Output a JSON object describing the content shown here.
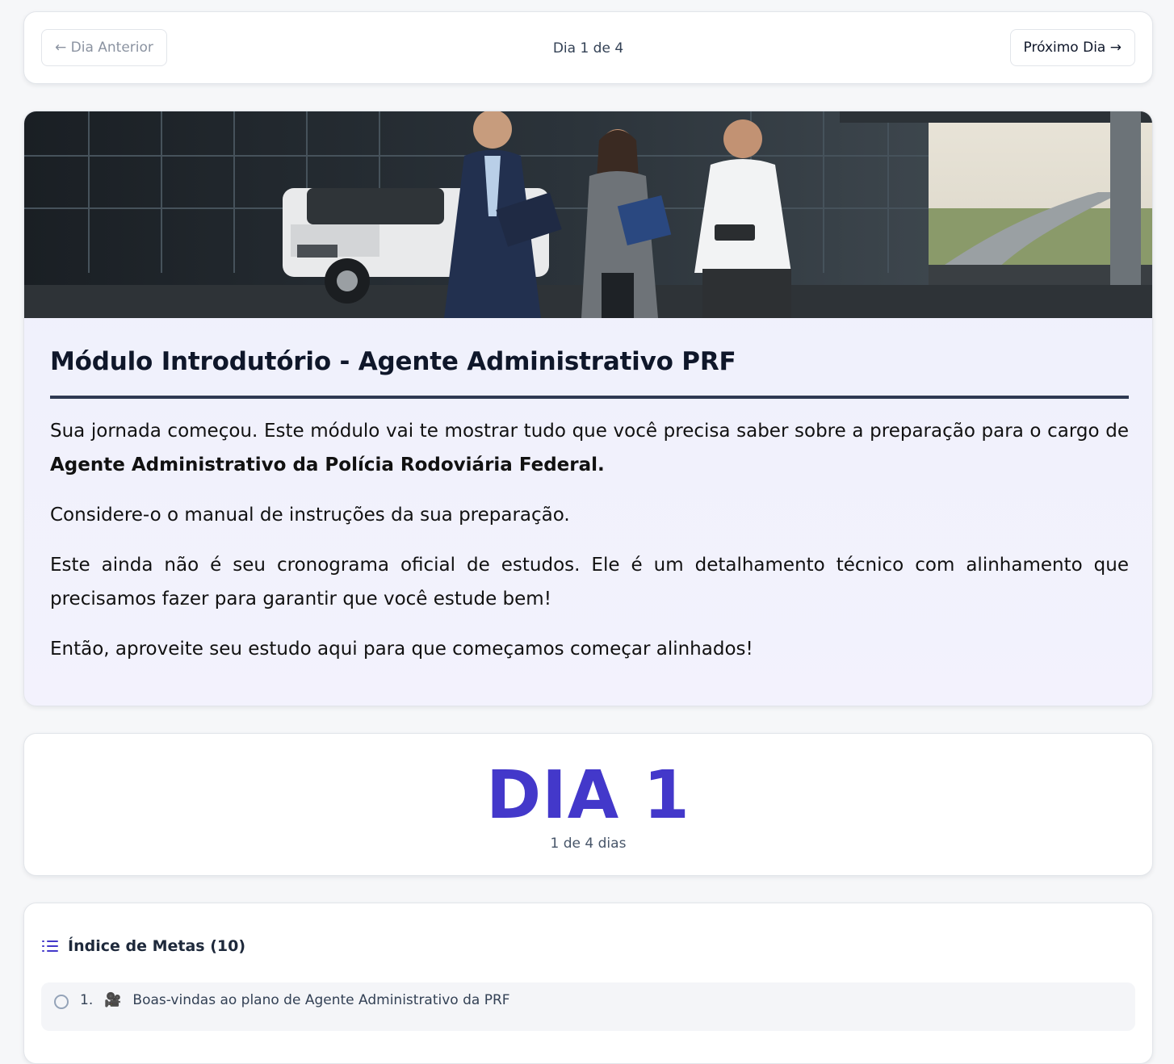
{
  "nav": {
    "prev_label": "← Dia Anterior",
    "counter": "Dia 1 de 4",
    "next_label": "Próximo Dia →"
  },
  "hero": {
    "title": "Módulo Introdutório - Agente Administrativo PRF",
    "p1_text": "Sua jornada começou. Este módulo vai te mostrar tudo que você precisa saber sobre a preparação para o cargo de ",
    "p1_bold": "Agente Administrativo da Polícia Rodoviária Federal.",
    "p2": "Considere-o o manual de instruções da sua preparação.",
    "p3": "Este ainda não é seu cronograma oficial de estudos. Ele é um detalhamento técnico com alinhamento que precisamos fazer para garantir que você estude bem!",
    "p4": "Então, aproveite seu estudo aqui para que começamos começar alinhados!"
  },
  "day": {
    "title": "DIA 1",
    "subtitle": "1 de 4 dias"
  },
  "index": {
    "title": "Índice de Metas (10)",
    "items": [
      {
        "number": "1.",
        "label": "Boas-vindas ao plano de Agente Administrativo da PRF"
      }
    ]
  },
  "colors": {
    "accent": "#4338ca",
    "rule": "#2f3a52",
    "hero_bg": "#f3f2fd"
  }
}
